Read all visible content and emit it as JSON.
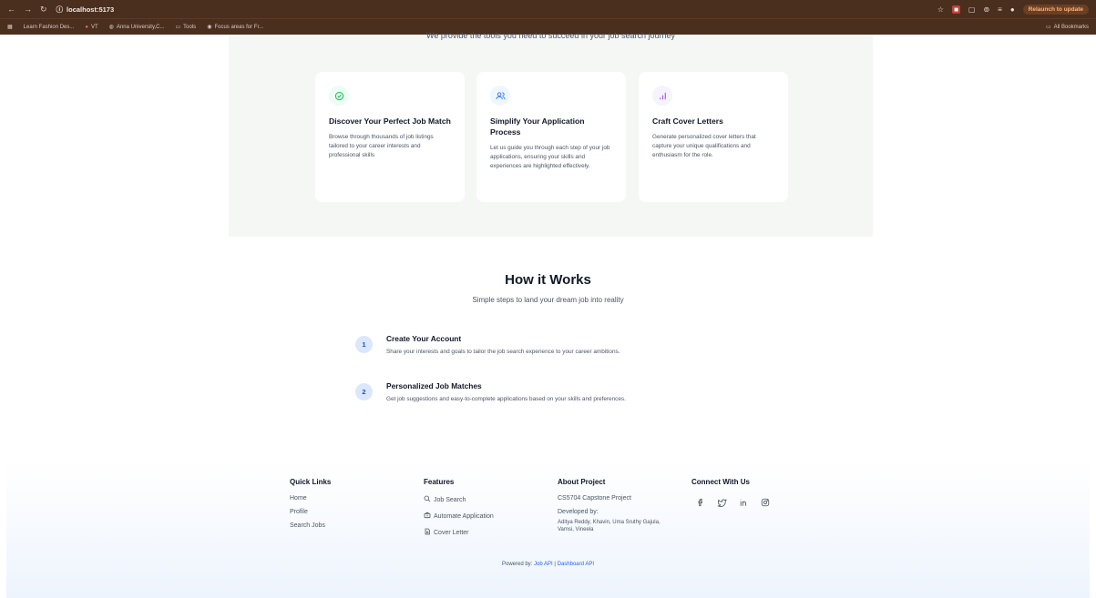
{
  "browser": {
    "url": "localhost:5173",
    "relaunch_label": "Relaunch to update",
    "bookmarks": [
      "Learn Fashion Des...",
      "VT",
      "Anna University,C...",
      "Tools",
      "Focus areas for Fr..."
    ],
    "all_bookmarks": "All Bookmarks"
  },
  "features": {
    "subtitle": "We provide the tools you need to succeed in your job search journey",
    "cards": [
      {
        "title": "Discover Your Perfect Job Match",
        "desc": "Browse through thousands of job listings tailored to your career interests and professional skills",
        "icon": "check-circle-icon",
        "color": "#22c55e",
        "bg": "#ecfdf3"
      },
      {
        "title": "Simplify Your Application Process",
        "desc": "Let us guide you through each step of your job applications, ensuring your skills and experiences are highlighted effectively.",
        "icon": "users-icon",
        "color": "#3b82f6",
        "bg": "#eff6ff"
      },
      {
        "title": "Craft Cover Letters",
        "desc": "Generate personalized cover letters that capture your unique qualifications and enthusiasm for the role.",
        "icon": "bar-chart-icon",
        "color": "#a855f7",
        "bg": "#f5f3ff"
      }
    ]
  },
  "how": {
    "title": "How it Works",
    "subtitle": "Simple steps to land your dream job into reality",
    "steps": [
      {
        "num": "1",
        "title": "Create Your Account",
        "desc": "Share your interests and goals to tailor the job search experience to your career ambitions."
      },
      {
        "num": "2",
        "title": "Personalized Job Matches",
        "desc": "Get job suggestions and easy-to-complete applications based on your skills and preferences."
      }
    ]
  },
  "footer": {
    "quick_links": {
      "title": "Quick Links",
      "items": [
        "Home",
        "Profile",
        "Search Jobs"
      ]
    },
    "features": {
      "title": "Features",
      "items": [
        "Job Search",
        "Automate Application",
        "Cover Letter"
      ]
    },
    "about": {
      "title": "About Project",
      "line1": "CS5704 Capstone Project",
      "line2": "Developed by:",
      "line3": "Aditya Reddy, Khavin, Uma Sruthy Gajula, Vamsi, Vineela"
    },
    "connect": {
      "title": "Connect With Us"
    },
    "powered_prefix": "Powered by:",
    "powered_link1": "Job API",
    "powered_sep": "|",
    "powered_link2": "Dashboard API"
  }
}
